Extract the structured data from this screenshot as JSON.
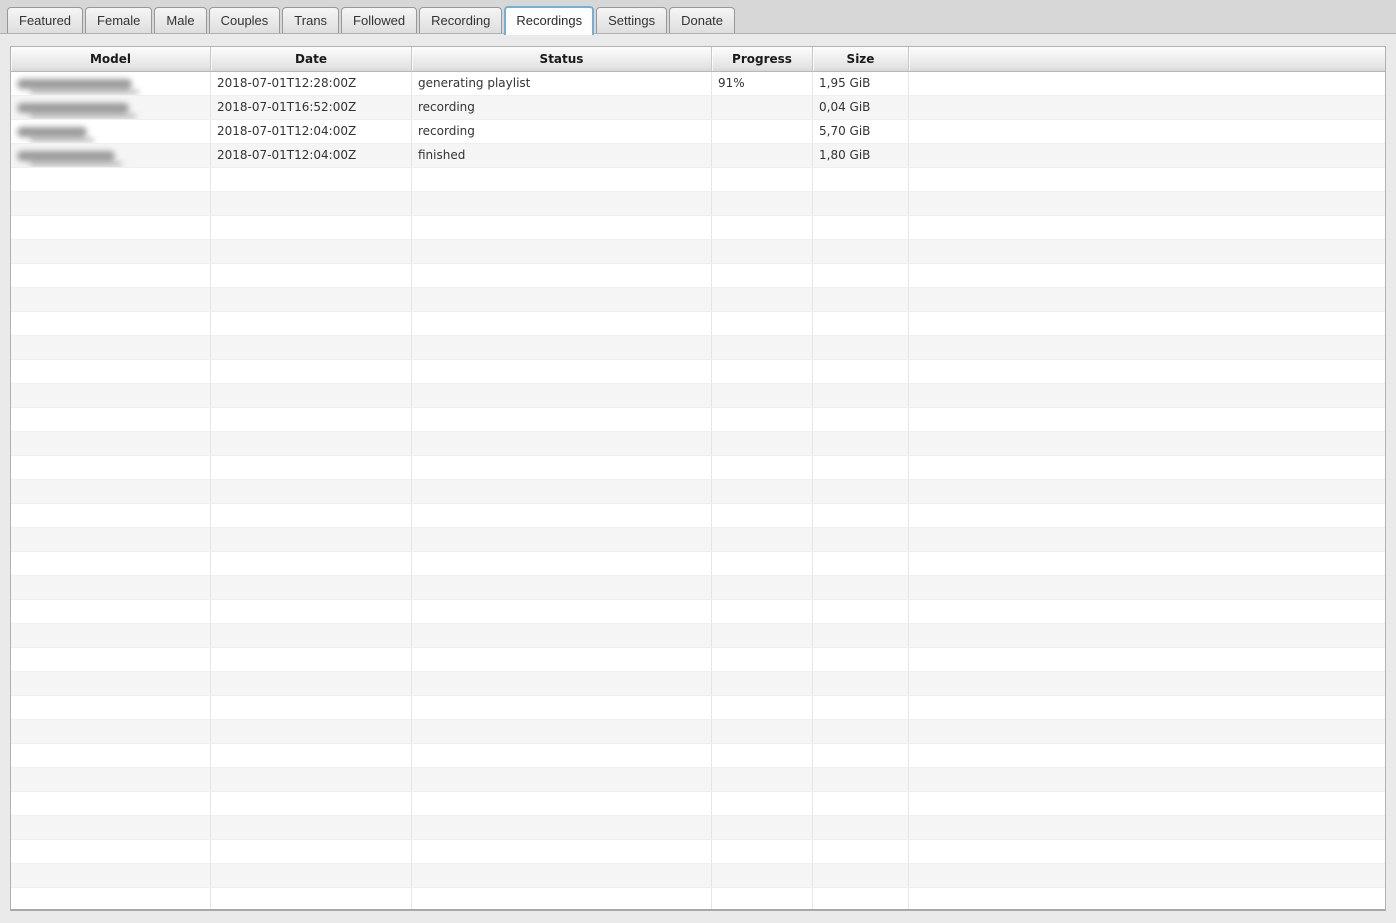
{
  "tabs": [
    {
      "label": "Featured",
      "active": false
    },
    {
      "label": "Female",
      "active": false
    },
    {
      "label": "Male",
      "active": false
    },
    {
      "label": "Couples",
      "active": false
    },
    {
      "label": "Trans",
      "active": false
    },
    {
      "label": "Followed",
      "active": false
    },
    {
      "label": "Recording",
      "active": false
    },
    {
      "label": "Recordings",
      "active": true
    },
    {
      "label": "Settings",
      "active": false
    },
    {
      "label": "Donate",
      "active": false
    }
  ],
  "table": {
    "columns": [
      {
        "key": "model",
        "label": "Model"
      },
      {
        "key": "date",
        "label": "Date"
      },
      {
        "key": "status",
        "label": "Status"
      },
      {
        "key": "progress",
        "label": "Progress"
      },
      {
        "key": "size",
        "label": "Size"
      },
      {
        "key": "filler",
        "label": ""
      }
    ],
    "rows": [
      {
        "model": "",
        "model_redacted": true,
        "model_blur_width": 115,
        "date": "2018-07-01T12:28:00Z",
        "status": "generating playlist",
        "progress": "91%",
        "size": "1,95 GiB"
      },
      {
        "model": "",
        "model_redacted": true,
        "model_blur_width": 112,
        "date": "2018-07-01T16:52:00Z",
        "status": "recording",
        "progress": "",
        "size": "0,04 GiB"
      },
      {
        "model": "",
        "model_redacted": true,
        "model_blur_width": 70,
        "date": "2018-07-01T12:04:00Z",
        "status": "recording",
        "progress": "",
        "size": "5,70 GiB"
      },
      {
        "model": "",
        "model_redacted": true,
        "model_blur_width": 98,
        "date": "2018-07-01T12:04:00Z",
        "status": "finished",
        "progress": "",
        "size": "1,80 GiB"
      }
    ],
    "empty_row_count": 31
  },
  "colors": {
    "accent_tab_border": "#72b0d8",
    "page_background": "#eaeaea",
    "tabbar_background": "#d7d7d7",
    "row_stripe": "#f5f5f5",
    "table_border": "#b2b2b2"
  }
}
